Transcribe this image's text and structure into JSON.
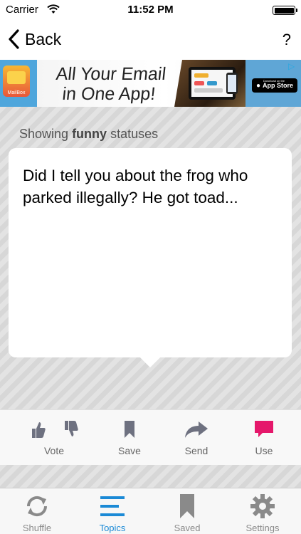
{
  "status_bar": {
    "carrier": "Carrier",
    "time": "11:52 PM"
  },
  "nav": {
    "back_label": "Back",
    "help_label": "?"
  },
  "ad": {
    "headline_line1": "All Your Email",
    "headline_line2": "in One App!",
    "brand": "MailBox",
    "store_small": "Download on the",
    "store_label": "App Store"
  },
  "content": {
    "showing_prefix": "Showing",
    "showing_topic": "funny",
    "showing_suffix": "statuses",
    "status_text": "Did I tell you about the frog who parked illegally? He got toad..."
  },
  "actions": [
    {
      "label": "Vote"
    },
    {
      "label": "Save"
    },
    {
      "label": "Send"
    },
    {
      "label": "Use"
    }
  ],
  "tabs": [
    {
      "label": "Shuffle",
      "active": false
    },
    {
      "label": "Topics",
      "active": true
    },
    {
      "label": "Saved",
      "active": false
    },
    {
      "label": "Settings",
      "active": false
    }
  ],
  "colors": {
    "accent": "#1b8ad6",
    "use_pink": "#e5186b",
    "icon_gray": "#6e7180"
  }
}
